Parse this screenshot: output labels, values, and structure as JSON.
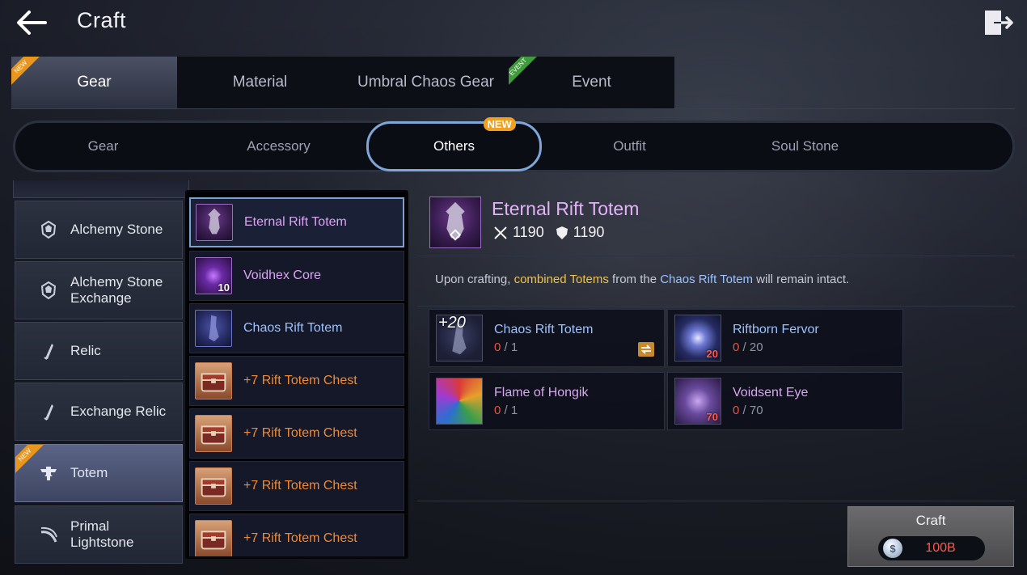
{
  "header": {
    "title": "Craft",
    "back_icon": "back-arrow-icon",
    "exit_icon": "exit-icon"
  },
  "main_tabs": [
    {
      "label": "Gear",
      "badge": "NEW",
      "badge_color": "#e8961d",
      "active": true
    },
    {
      "label": "Material"
    },
    {
      "label": "Umbral Chaos Gear",
      "badge": "EVENT",
      "badge_color": "#3f9a3b"
    },
    {
      "label": "Event"
    }
  ],
  "sub_tabs": [
    {
      "label": "Gear"
    },
    {
      "label": "Accessory"
    },
    {
      "label": "Others",
      "badge": "NEW",
      "active": true
    },
    {
      "label": "Outfit"
    },
    {
      "label": "Soul Stone"
    }
  ],
  "categories": [
    {
      "label": "Alchemy Stone",
      "icon": "stone-icon"
    },
    {
      "label": "Alchemy Stone\nExchange",
      "icon": "stone-icon"
    },
    {
      "label": "Relic",
      "icon": "relic-icon"
    },
    {
      "label": "Exchange Relic",
      "icon": "relic-icon"
    },
    {
      "label": "Totem",
      "icon": "totem-icon",
      "badge": "NEW",
      "active": true
    },
    {
      "label": "Primal\nLightstone",
      "icon": "lightstone-icon"
    }
  ],
  "items": [
    {
      "name": "Eternal Rift Totem",
      "active": true
    },
    {
      "name": "Voidhex Core",
      "qty": "10"
    },
    {
      "name": "Chaos Rift Totem"
    },
    {
      "name": "+7 Rift Totem Chest"
    },
    {
      "name": "+7 Rift Totem Chest"
    },
    {
      "name": "+7 Rift Totem Chest"
    },
    {
      "name": "+7 Rift Totem Chest"
    }
  ],
  "detail": {
    "title": "Eternal Rift Totem",
    "attack": "1190",
    "defense": "1190",
    "desc_pre": "Upon crafting, ",
    "desc_hl1": "combined Totems",
    "desc_mid": " from the ",
    "desc_hl2": "Chaos Rift Totem",
    "desc_post": " will remain intact."
  },
  "materials": [
    {
      "name": "Chaos Rift Totem",
      "have": "0",
      "sep": " / ",
      "need": "1",
      "level": "+20"
    },
    {
      "name": "Riftborn Fervor",
      "have": "0",
      "sep": " / ",
      "need": "20",
      "qty": "20"
    },
    {
      "name": "Flame of Hongik",
      "have": "0",
      "sep": " / ",
      "need": "1"
    },
    {
      "name": "Voidsent Eye",
      "have": "0",
      "sep": " / ",
      "need": "70",
      "qty": "70"
    }
  ],
  "craft": {
    "label": "Craft",
    "coin_symbol": "$",
    "cost": "100B"
  },
  "colors": {
    "accent_blue": "#7ea6d9",
    "name_purple": "#d9a6f2",
    "name_orange": "#f28a35",
    "cost_red": "#ff5a4a"
  }
}
